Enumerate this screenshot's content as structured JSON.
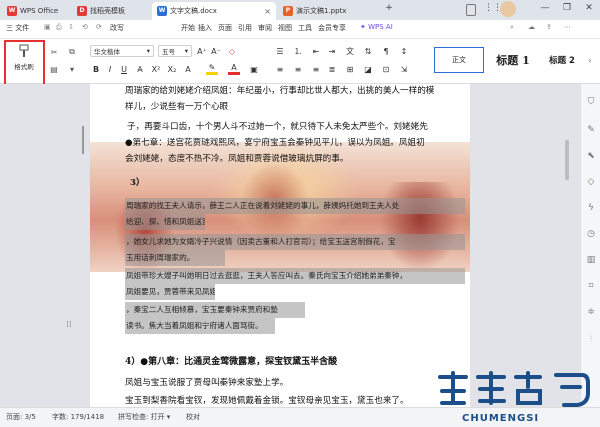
{
  "tabs": [
    {
      "label": "WPS Office",
      "icon": "wps-logo-icon",
      "color": "#e53935"
    },
    {
      "label": "找稻壳模板",
      "icon": "docer-icon",
      "color": "#e53935"
    },
    {
      "label": "文字文稿.docx",
      "icon": "word-doc-icon",
      "color": "#2b6fd6",
      "active": true
    },
    {
      "label": "演示文稿1.pptx",
      "icon": "ppt-doc-icon",
      "color": "#e8602c"
    }
  ],
  "menu": {
    "file": "三 文件",
    "undo_label": "⟲",
    "redo_label": "⟳",
    "view_mode": "改写",
    "items": [
      "开始",
      "插入",
      "页面",
      "引用",
      "审阅",
      "视图",
      "工具",
      "会员专享"
    ],
    "active": "开始",
    "ai": "WPS AI"
  },
  "ribbon": {
    "format_painter": "格式刷",
    "font_name": "华文楷体",
    "font_size": "五号",
    "style_normal": "正文",
    "style_h1": "标题 1",
    "style_h2": "标题 2"
  },
  "document": {
    "lines": [
      "周瑞家的给刘姥姥介绍凤姐：年纪虽小，行事却比世人都大，出挑的美人一样的模",
      "样儿，少说些有一万个心眼",
      "子，再要斗口齿，十个男人斗不过她一个，就只待下人未免太严些个。刘姥姥先",
      "●第七章：送宫花贾琏戏熙凤，宴宁府宝玉会秦钟见平儿，误以为凤姐。凤姐初",
      "会刘姥姥，态度不热不冷。凤姐和贾蓉说借玻璃炕屏的事。",
      "3）",
      "周瑞家的找王夫人请示，薛王二人正在说着刘姥姥的事儿，薛姨妈托她到王夫人处",
      "给迎、探、惜和凤姐送宫花",
      "，她女儿求她为女婿冷子兴说情（因卖古董和人打官司）；给宝玉送宫制假花，宝",
      "玉用话刺周瑞家的。",
      "凤姐带珍大嫂子叫她明日过去逛逛，王夫人答应叫去。秦氏向宝玉介绍她弟弟秦钟，",
      "凤姐要见，贾蓉带来见凤姐",
      "，秦宝二人互相倾慕，宝玉要秦钟来贾府和塾",
      "读书。焦大当着凤姐和宁府诸人面骂街。",
      "4）●第八章：比通灵金莺微露意，探宝钗黛玉半含酸",
      "凤姐与宝玉说服了贾母叫秦钟来家塾上学。",
      "宝玉到梨香院看宝钗，发现她佩戴着金锁。宝钗母亲见宝玉，黛玉也来了。"
    ]
  },
  "statusbar": {
    "page": "页面: 3/5",
    "words": "字数: 179/1418",
    "spell": "拼写检查: 打开 ▾",
    "proof": "校对"
  },
  "watermark": {
    "text": "CHUMENGSI"
  }
}
